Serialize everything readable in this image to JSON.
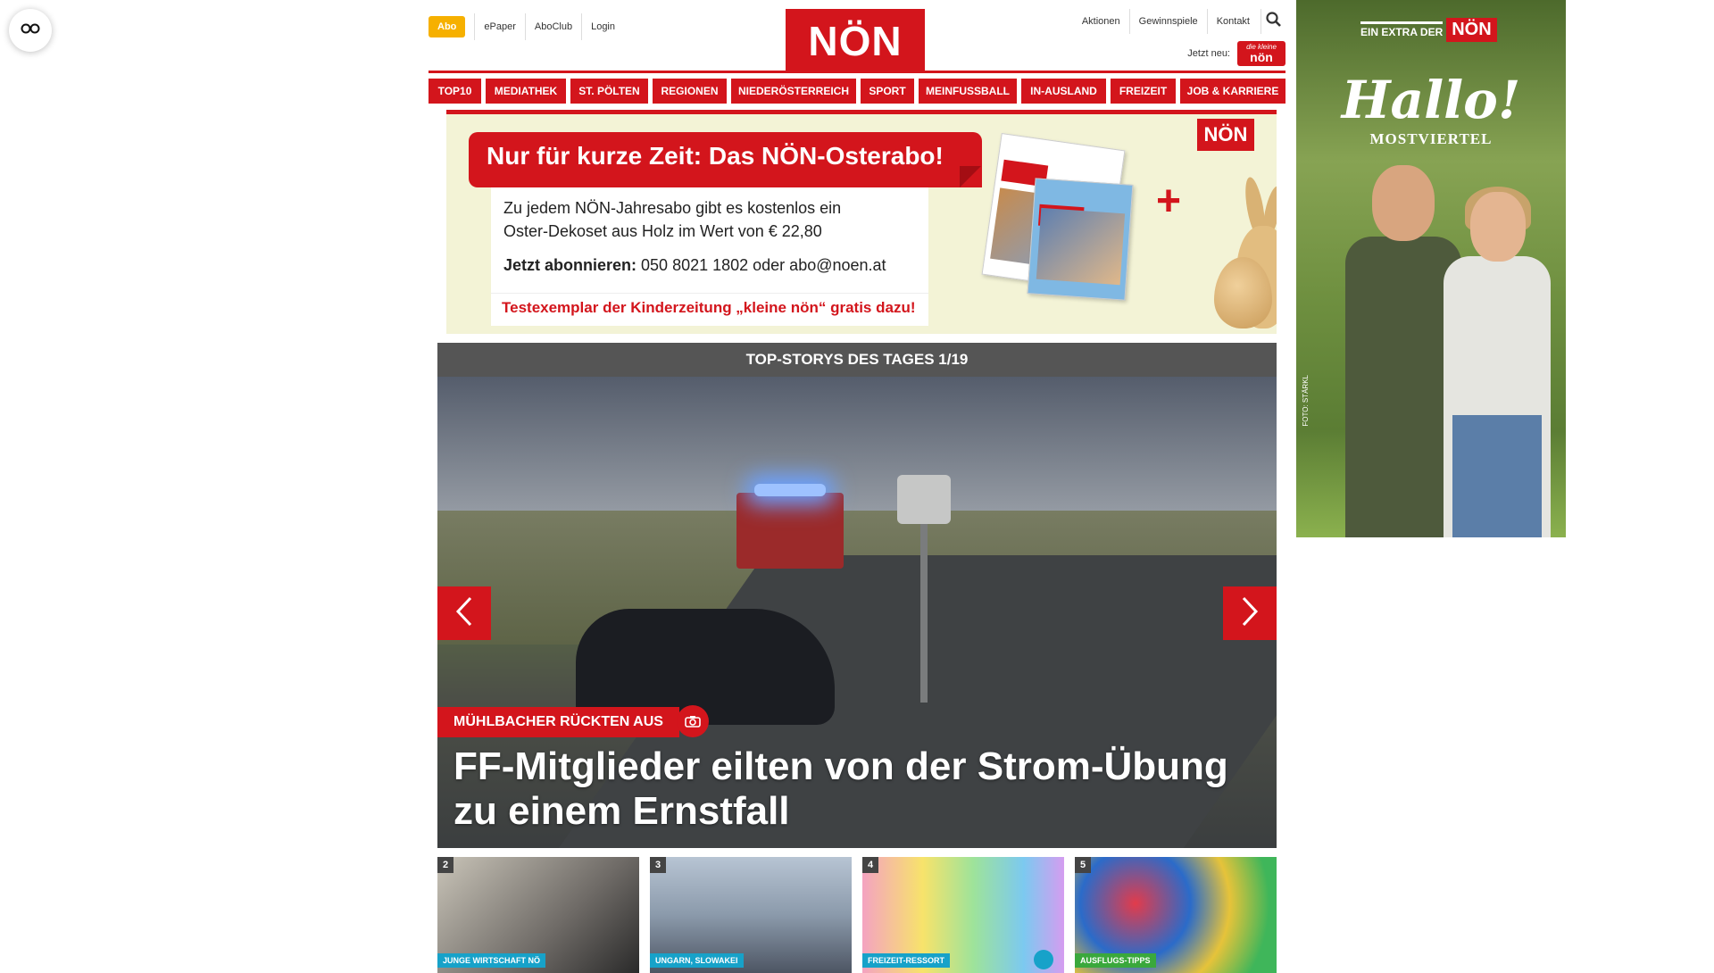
{
  "accessibility": {
    "icon": "glasses-icon"
  },
  "header": {
    "abo_label": "Abo",
    "left_links": [
      "ePaper",
      "AboClub",
      "Login"
    ],
    "logo_text": "NÖN",
    "right_links": [
      "Aktionen",
      "Gewinnspiele",
      "Kontakt"
    ],
    "search_icon": "search-icon",
    "jetzt_label": "Jetzt neu:",
    "kleine_logo": {
      "top": "die kleine",
      "main": "nön"
    }
  },
  "nav": {
    "items": [
      {
        "label": "TOP10",
        "width": 59
      },
      {
        "label": "MEDIATHEK",
        "width": 90
      },
      {
        "label": "ST. PÖLTEN",
        "width": 87
      },
      {
        "label": "REGIONEN",
        "width": 83
      },
      {
        "label": "NIEDERÖSTERREICH",
        "width": 140
      },
      {
        "label": "SPORT",
        "width": 60
      },
      {
        "label": "MEINFUSSBALL",
        "width": 110
      },
      {
        "label": "IN-AUSLAND",
        "width": 95
      },
      {
        "label": "FREIZEIT",
        "width": 73
      },
      {
        "label": "JOB & KARRIERE",
        "width": 118
      }
    ]
  },
  "promo": {
    "headline": "Nur für kurze Zeit: Das NÖN-Osterabo!",
    "line1": "Zu jedem NÖN-Jahresabo gibt es kostenlos ein",
    "line2": "Oster-Dekoset aus Holz im Wert von € 22,80",
    "cta_bold": "Jetzt abonnieren:",
    "cta_rest": " 050 8021 1802 oder abo@noen.at",
    "extra": "Testexemplar der Kinderzeitung „kleine nön“ gratis dazu!",
    "logo": "NÖN",
    "plus": "+"
  },
  "story": {
    "bar_title": "TOP-STORYS DES TAGES 1/19",
    "tag": "MÜHLBACHER RÜCKTEN AUS",
    "title": "FF-Mitglieder eilten von der Strom-Übung zu einem Ernstfall",
    "prev_icon": "chevron-left-icon",
    "next_icon": "chevron-right-icon",
    "camera_icon": "camera-icon"
  },
  "thumbs": [
    {
      "num": "2",
      "tag": "JUNGE WIRTSCHAFT NÖ",
      "cls": "t1",
      "tag_color": "blue"
    },
    {
      "num": "3",
      "tag": "UNGARN, SLOWAKEI",
      "cls": "t2",
      "tag_color": "blue"
    },
    {
      "num": "4",
      "tag": "FREIZEIT-RESSORT",
      "cls": "t3",
      "tag_color": "blue"
    },
    {
      "num": "5",
      "tag": "AUSFLUGS-TIPPS",
      "cls": "t4",
      "tag_color": "green"
    }
  ],
  "ad": {
    "extra_text": "EIN EXTRA DER",
    "logo": "NÖN",
    "hallo": "Hallo!",
    "sub": "MOSTVIERTEL",
    "credit": "FOTO: STÄRKL"
  },
  "colors": {
    "brand_red": "#d3151c",
    "abo_yellow": "#f6b000",
    "tag_blue": "#17a2c9",
    "tag_green": "#3aa83c"
  }
}
